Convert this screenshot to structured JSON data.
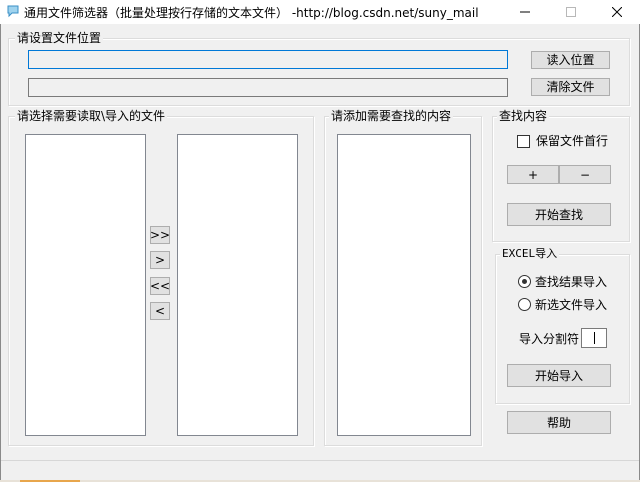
{
  "window": {
    "title": "通用文件筛选器（批量处理按行存储的文本文件） -http://blog.csdn.net/suny_mail",
    "icon": "speech-bubble-icon",
    "controls": {
      "minimize": "minimize-icon",
      "maximize": "maximize-icon",
      "close": "close-icon"
    }
  },
  "location_group": {
    "label": "请设置文件位置",
    "path_value": "",
    "files_value": "",
    "read_button": "读入位置",
    "clear_button": "清除文件"
  },
  "select_group": {
    "label": "请选择需要读取\\导入的文件",
    "source_items": [],
    "target_items": [],
    "transfer_buttons": {
      "add_all": ">>",
      "add_one": ">",
      "remove_all": "<<",
      "remove_one": "<"
    }
  },
  "content_group": {
    "label": "请添加需要查找的内容",
    "items": []
  },
  "find_group": {
    "label": "查找内容",
    "keep_first_line_label": "保留文件首行",
    "keep_first_line_checked": false,
    "plus_button": "+",
    "minus_button": "−",
    "start_find_button": "开始查找"
  },
  "excel_group": {
    "label": "EXCEL导入",
    "radio_find_results": "查找结果导入",
    "radio_new_file": "新选文件导入",
    "selected_radio": "find_results",
    "delimiter_label": "导入分割符：",
    "delimiter_value": "",
    "start_import_button": "开始导入"
  },
  "help_button": "帮助",
  "colors": {
    "client_bg": "#f0f0f0",
    "focus_border": "#0078d7",
    "button_bg": "#e1e1e1",
    "button_border": "#adadad",
    "list_bg": "#ffffff"
  }
}
